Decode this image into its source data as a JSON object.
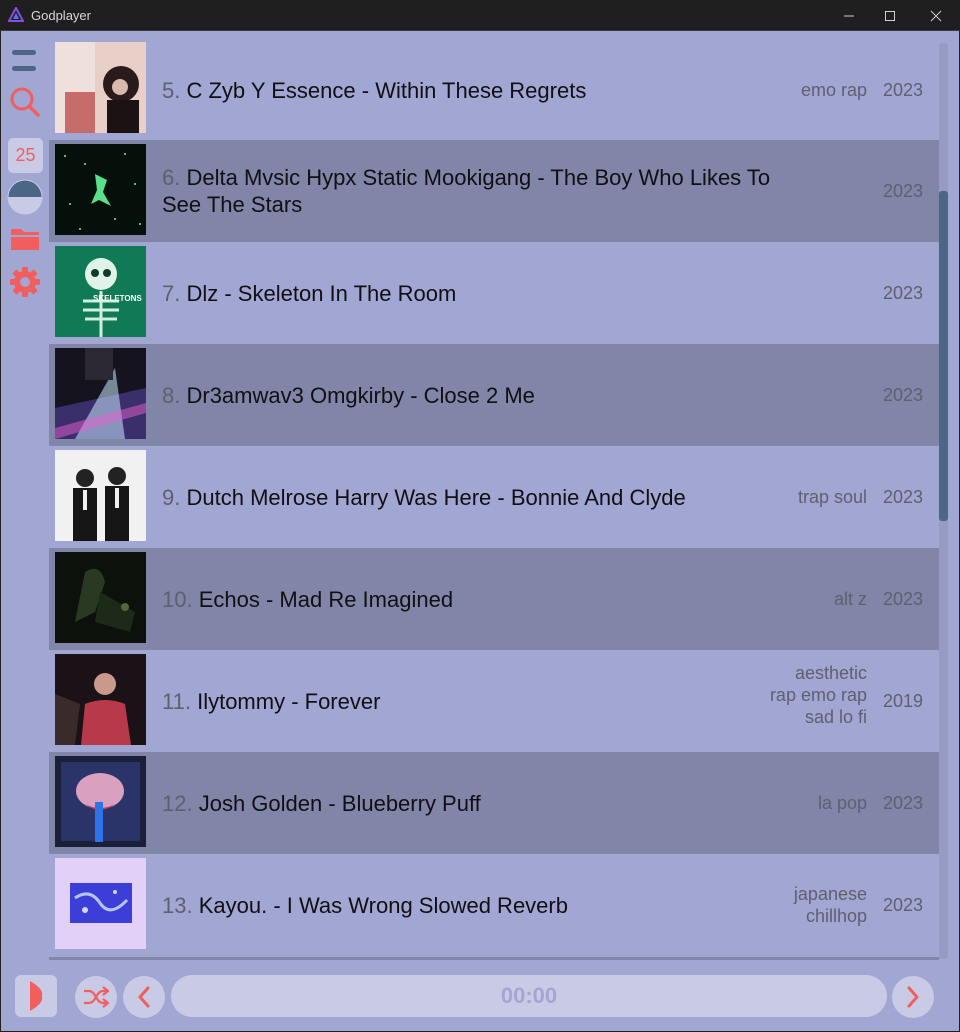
{
  "window": {
    "title": "Godplayer"
  },
  "sidebar": {
    "count_badge": "25"
  },
  "tracks": [
    {
      "num": "5.",
      "title": "C Zyb Y Essence - Within These Regrets",
      "genre": "emo rap",
      "year": "2023"
    },
    {
      "num": "6.",
      "title": "Delta Mvsic Hypx Static Mookigang - The Boy Who Likes To See The Stars",
      "genre": "",
      "year": "2023"
    },
    {
      "num": "7.",
      "title": "Dlz - Skeleton In The Room",
      "genre": "",
      "year": "2023",
      "cover_text": "SKELETONS"
    },
    {
      "num": "8.",
      "title": "Dr3amwav3 Omgkirby - Close 2 Me",
      "genre": "",
      "year": "2023"
    },
    {
      "num": "9.",
      "title": "Dutch Melrose Harry Was Here - Bonnie And Clyde",
      "genre": "trap soul",
      "year": "2023"
    },
    {
      "num": "10.",
      "title": "Echos - Mad Re Imagined",
      "genre": "alt z",
      "year": "2023"
    },
    {
      "num": "11.",
      "title": "Ilytommy - Forever",
      "genre": "aesthetic rap emo rap sad lo fi",
      "year": "2019"
    },
    {
      "num": "12.",
      "title": "Josh Golden - Blueberry Puff",
      "genre": "la pop",
      "year": "2023"
    },
    {
      "num": "13.",
      "title": "Kayou. - I Was Wrong Slowed Reverb",
      "genre": "japanese chillhop",
      "year": "2023"
    }
  ],
  "player": {
    "time": "00:00"
  },
  "colors": {
    "background": "#a2a6d2",
    "alt_row": "#8185a7",
    "accent": "#f25d5d",
    "button": "#c9cbe6",
    "scroll_thumb": "#4c6686"
  },
  "icons": [
    "app-logo-icon",
    "minimize-icon",
    "maximize-icon",
    "close-icon",
    "menu-icon",
    "search-icon",
    "theme-icon",
    "folder-icon",
    "settings-icon",
    "play-icon",
    "shuffle-icon",
    "prev-icon",
    "next-icon"
  ]
}
